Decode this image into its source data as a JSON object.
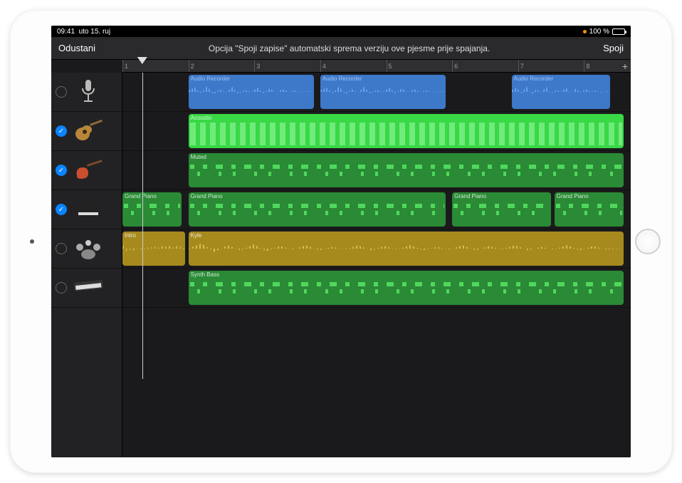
{
  "status": {
    "time": "09:41",
    "date": "uto 15. ruj",
    "battery": "100 %"
  },
  "toolbar": {
    "cancel": "Odustani",
    "message": "Opcija \"Spoji zapise\" automatski sprema verziju ove pjesme prije spajanja.",
    "merge": "Spoji"
  },
  "ruler": {
    "ticks": [
      "1",
      "2",
      "3",
      "4",
      "5",
      "6",
      "7",
      "8"
    ],
    "plus": "+"
  },
  "playhead_bar": 1.3,
  "tracks": [
    {
      "id": "audio-rec",
      "icon": "microphone-icon",
      "checked": false,
      "regions": [
        {
          "label": "Audio Recorder",
          "color": "blue",
          "start": 2,
          "end": 3.9,
          "wave": "blue"
        },
        {
          "label": "Audio Recorder",
          "color": "blue",
          "start": 4,
          "end": 5.9,
          "wave": "blue"
        },
        {
          "label": "Audio Recorder",
          "color": "blue",
          "start": 6.9,
          "end": 8.4,
          "wave": "blue"
        }
      ]
    },
    {
      "id": "acoustic",
      "icon": "guitar-acoustic-icon",
      "checked": true,
      "regions": [
        {
          "label": "Acoustic",
          "color": "green-bright",
          "start": 2,
          "end": 8.6,
          "wave": "midi-bright"
        }
      ]
    },
    {
      "id": "bass",
      "icon": "guitar-bass-icon",
      "checked": true,
      "regions": [
        {
          "label": "Muted",
          "color": "green",
          "start": 2,
          "end": 8.6,
          "wave": "midi"
        }
      ]
    },
    {
      "id": "piano",
      "icon": "piano-icon",
      "checked": true,
      "regions": [
        {
          "label": "Grand Piano",
          "color": "green",
          "start": 1,
          "end": 1.9,
          "wave": "midi"
        },
        {
          "label": "Grand Piano",
          "color": "green",
          "start": 2,
          "end": 5.9,
          "wave": "midi"
        },
        {
          "label": "Grand Piano",
          "color": "green",
          "start": 6,
          "end": 7.5,
          "wave": "midi"
        },
        {
          "label": "Grand Piano",
          "color": "green",
          "start": 7.55,
          "end": 8.6,
          "wave": "midi"
        }
      ]
    },
    {
      "id": "drums",
      "icon": "drums-icon",
      "checked": false,
      "regions": [
        {
          "label": "Intro",
          "color": "olive",
          "start": 1,
          "end": 1.95,
          "wave": "olive"
        },
        {
          "label": "Kyle",
          "color": "olive",
          "start": 2,
          "end": 8.6,
          "wave": "olive"
        }
      ]
    },
    {
      "id": "synth",
      "icon": "keyboard-icon",
      "checked": false,
      "regions": [
        {
          "label": "Synth Bass",
          "color": "green",
          "start": 2,
          "end": 8.6,
          "wave": "midi"
        }
      ]
    }
  ]
}
